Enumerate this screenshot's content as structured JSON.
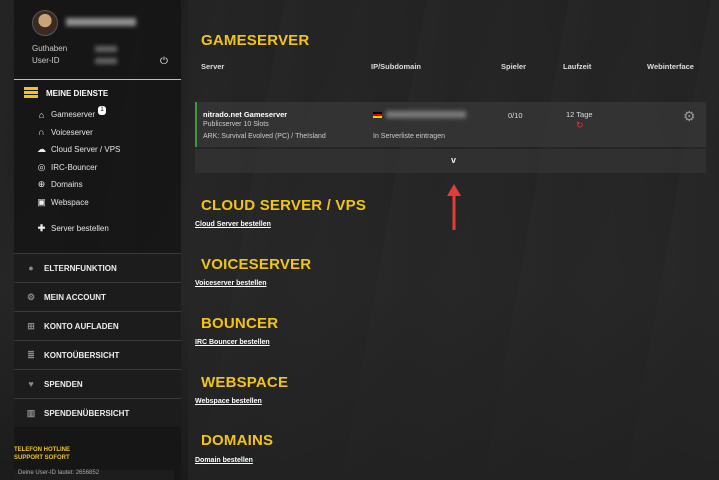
{
  "sidebar": {
    "guthaben_label": "Guthaben",
    "userid_label": "User-ID",
    "section_title": "MEINE DIENSTE",
    "items": [
      {
        "label": "Gameserver",
        "icon": "gamepad-icon",
        "badge": "1"
      },
      {
        "label": "Voiceserver",
        "icon": "headset-icon"
      },
      {
        "label": "Cloud Server / VPS",
        "icon": "cloud-icon"
      },
      {
        "label": "IRC-Bouncer",
        "icon": "irc-icon"
      },
      {
        "label": "Domains",
        "icon": "globe-icon"
      },
      {
        "label": "Webspace",
        "icon": "webspace-icon"
      }
    ],
    "order_label": "Server bestellen",
    "sections": [
      {
        "label": "ELTERNFUNKTION",
        "icon": "users-icon"
      },
      {
        "label": "MEIN ACCOUNT",
        "icon": "account-gear-icon"
      },
      {
        "label": "KONTO AUFLADEN",
        "icon": "cart-icon"
      },
      {
        "label": "KONTOÜBERSICHT",
        "icon": "list-icon"
      },
      {
        "label": "SPENDEN",
        "icon": "heart-icon"
      },
      {
        "label": "SPENDENÜBERSICHT",
        "icon": "chart-icon"
      }
    ],
    "hotline_line1": "TELEFON HOTLINE",
    "hotline_line2": "SUPPORT SOFORT",
    "userid_footer": "Deine User-ID lautet: 2656852"
  },
  "main": {
    "gameserver_title": "GAMESERVER",
    "columns": [
      "Server",
      "IP/Subdomain",
      "Spieler",
      "Laufzeit",
      "Webinterface"
    ],
    "server": {
      "name": "nitrado.net Gameserver",
      "slots": "Publicserver 10 Slots",
      "game": "ARK: Survival Evolved (PC) / TheIsland",
      "register": "In Serverliste eintragen",
      "players": "0/10",
      "runtime": "12 Tage"
    },
    "expand_symbol": "v",
    "sections": [
      {
        "title": "CLOUD SERVER / VPS",
        "link": "Cloud Server bestellen"
      },
      {
        "title": "VOICESERVER",
        "link": "Voiceserver bestellen"
      },
      {
        "title": "BOUNCER",
        "link": "IRC Bouncer bestellen"
      },
      {
        "title": "WEBSPACE",
        "link": "Webspace bestellen"
      },
      {
        "title": "DOMAINS",
        "link": "Domain bestellen"
      }
    ]
  },
  "colors": {
    "accent": "#f0c419",
    "status_ok": "#3c9a3c",
    "arrow": "#e23b3b"
  }
}
